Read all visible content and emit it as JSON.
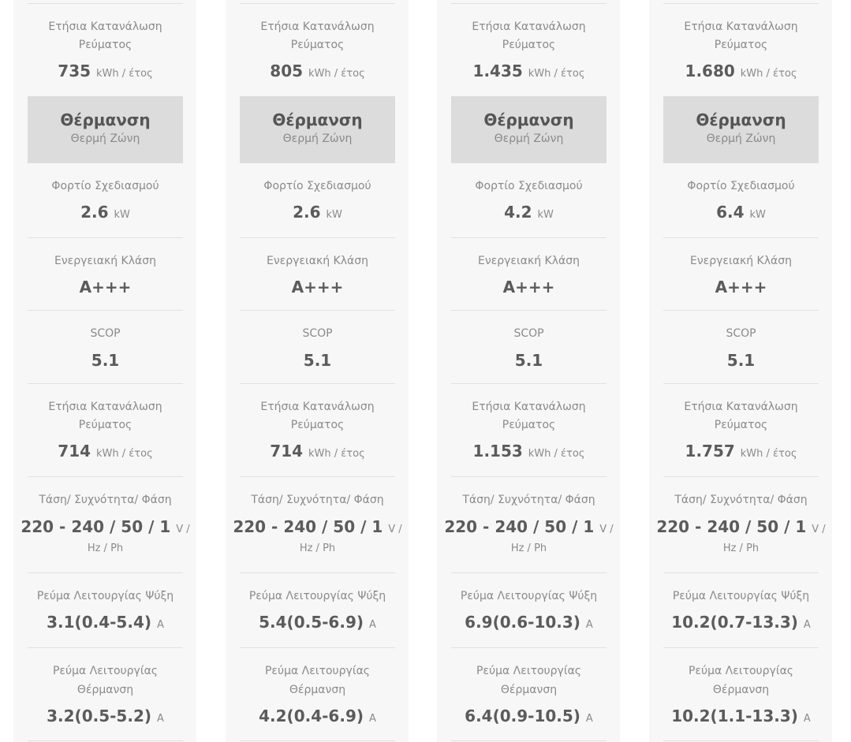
{
  "texts": {
    "annual_consumption_label": "Ετήσια Κατανάλωση",
    "annual_consumption_label2": "Ρεύματος",
    "heating_title": "Θέρμανση",
    "heating_sub": "Θερμή Ζώνη",
    "design_load_label": "Φορτίο Σχεδιασμού",
    "energy_class_label": "Ενεργειακή Κλάση",
    "scop_label": "SCOP",
    "voltage_label": "Τάση/ Συχνότητα/ Φάση",
    "current_cooling_label": "Ρεύμα Λειτουργίας Ψύξη",
    "current_heating_label": "Ρεύμα Λειτουργίας",
    "current_heating_label2": "Θέρμανση",
    "unit_kwh_year": "kWh / έτος",
    "unit_kw": "kW",
    "unit_v": "V /",
    "unit_hz_ph": "Hz / Ph",
    "unit_a": "A"
  },
  "columns": [
    {
      "cooling_consumption": "735",
      "design_load": "2.6",
      "energy_class": "A+++",
      "scop": "5.1",
      "heating_consumption": "714",
      "voltage": "220 - 240 / 50 / 1",
      "current_cooling": "3.1(0.4-5.4)",
      "current_heating": "3.2(0.5-5.2)"
    },
    {
      "cooling_consumption": "805",
      "design_load": "2.6",
      "energy_class": "A+++",
      "scop": "5.1",
      "heating_consumption": "714",
      "voltage": "220 - 240 / 50 / 1",
      "current_cooling": "5.4(0.5-6.9)",
      "current_heating": "4.2(0.4-6.9)"
    },
    {
      "cooling_consumption": "1.435",
      "design_load": "4.2",
      "energy_class": "A+++",
      "scop": "5.1",
      "heating_consumption": "1.153",
      "voltage": "220 - 240 / 50 / 1",
      "current_cooling": "6.9(0.6-10.3)",
      "current_heating": "6.4(0.9-10.5)"
    },
    {
      "cooling_consumption": "1.680",
      "design_load": "6.4",
      "energy_class": "A+++",
      "scop": "5.1",
      "heating_consumption": "1.757",
      "voltage": "220 - 240 / 50 / 1",
      "current_cooling": "10.2(0.7-13.3)",
      "current_heating": "10.2(1.1-13.3)"
    }
  ]
}
